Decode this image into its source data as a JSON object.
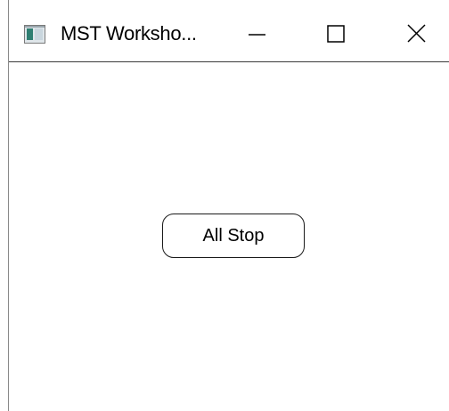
{
  "window": {
    "title": "MST Worksho...",
    "icon": "app-window-icon",
    "controls": {
      "minimize_icon": "minimize-icon",
      "maximize_icon": "maximize-icon",
      "close_icon": "close-icon"
    }
  },
  "main": {
    "all_stop_label": "All Stop"
  }
}
